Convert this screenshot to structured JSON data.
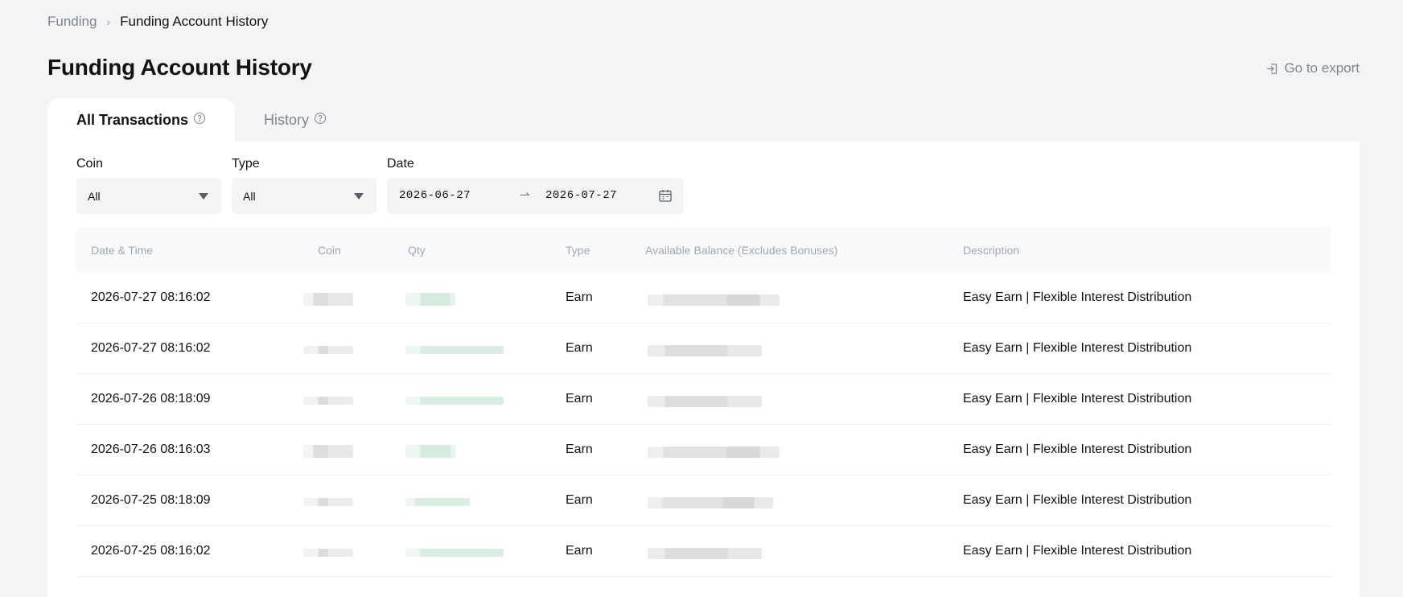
{
  "breadcrumb": {
    "parent": "Funding",
    "current": "Funding Account History"
  },
  "page_title": "Funding Account History",
  "export_label": "Go to export",
  "tabs": [
    {
      "label": "All Transactions",
      "active": true
    },
    {
      "label": "History",
      "active": false
    }
  ],
  "filters": {
    "coin": {
      "label": "Coin",
      "value": "All"
    },
    "type": {
      "label": "Type",
      "value": "All"
    },
    "date": {
      "label": "Date",
      "start": "2026-06-27",
      "end": "2026-07-27"
    }
  },
  "table": {
    "columns": [
      "Date & Time",
      "Coin",
      "Qty",
      "Type",
      "Available Balance (Excludes Bonuses)",
      "Description"
    ],
    "rows": [
      {
        "datetime": "2026-07-27 08:16:02",
        "type": "Earn",
        "description": "Easy Earn | Flexible Interest Distribution"
      },
      {
        "datetime": "2026-07-27 08:16:02",
        "type": "Earn",
        "description": "Easy Earn | Flexible Interest Distribution"
      },
      {
        "datetime": "2026-07-26 08:18:09",
        "type": "Earn",
        "description": "Easy Earn | Flexible Interest Distribution"
      },
      {
        "datetime": "2026-07-26 08:16:03",
        "type": "Earn",
        "description": "Easy Earn | Flexible Interest Distribution"
      },
      {
        "datetime": "2026-07-25 08:18:09",
        "type": "Earn",
        "description": "Easy Earn | Flexible Interest Distribution"
      },
      {
        "datetime": "2026-07-25 08:16:02",
        "type": "Earn",
        "description": "Easy Earn | Flexible Interest Distribution"
      }
    ]
  },
  "colors": {
    "accent_green_blur": "#d6eadd",
    "muted_text": "#81858c",
    "background": "#f3f4f6"
  }
}
